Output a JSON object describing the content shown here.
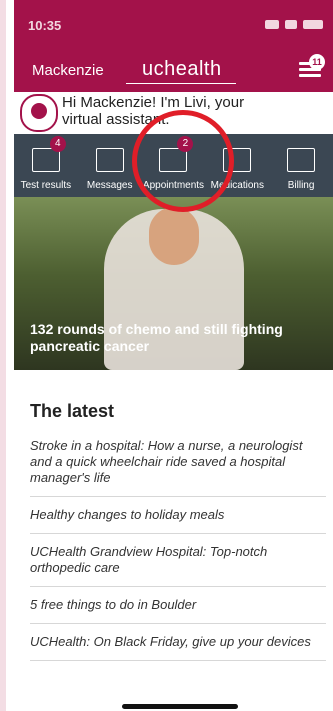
{
  "status": {
    "time": "10:35"
  },
  "header": {
    "user": "Mackenzie",
    "brand": "uchealth",
    "menu_badge": "11"
  },
  "assistant": {
    "message": "Hi Mackenzie! I'm Livi, your virtual assistant."
  },
  "nav": {
    "items": [
      {
        "label": "Test results",
        "badge": "4"
      },
      {
        "label": "Messages",
        "badge": ""
      },
      {
        "label": "Appointments",
        "badge": "2"
      },
      {
        "label": "Medications",
        "badge": ""
      },
      {
        "label": "Billing",
        "badge": ""
      }
    ]
  },
  "hero": {
    "caption": "132 rounds of chemo and still fighting pancreatic cancer"
  },
  "latest": {
    "title": "The latest",
    "articles": [
      "Stroke in a hospital: How a nurse, a neurologist and a quick wheelchair ride saved a hospital manager's life",
      "Healthy changes to holiday meals",
      "UCHealth Grandview Hospital: Top-notch orthopedic care",
      "5 free things to do in Boulder",
      "UCHealth: On Black Friday, give up your devices"
    ]
  }
}
